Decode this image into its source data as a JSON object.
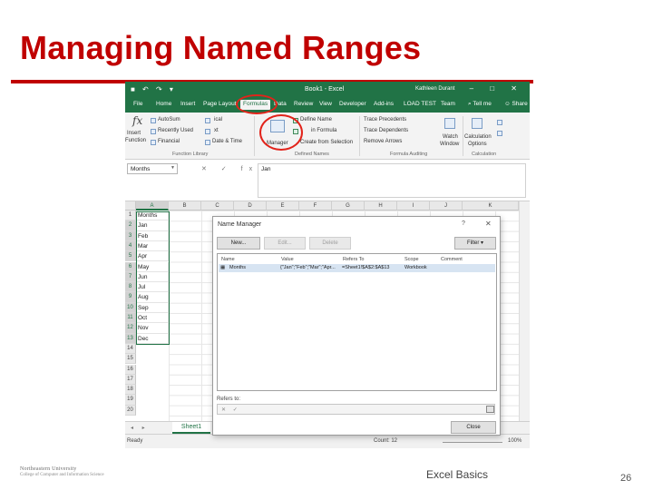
{
  "slide": {
    "title": "Managing Named Ranges",
    "footer_text": "Excel Basics",
    "page_number": "26",
    "logo_line1": "Northeastern University",
    "logo_line2": "College of Computer and Information Science",
    "accent_color": "#c00000"
  },
  "excel": {
    "qat": "■ ↶ ↷ ▾",
    "book_title": "Book1 - Excel",
    "user_name": "Kathleen Durant",
    "window_controls": "– □ ✕",
    "brand_color": "#217346",
    "tabs": [
      "File",
      "Home",
      "Insert",
      "Page Layout",
      "Formulas",
      "Data",
      "Review",
      "View",
      "Developer",
      "Add-ins",
      "LOAD TEST",
      "Team"
    ],
    "active_tab": "Formulas",
    "tell_me": "⌕ Tell me",
    "share": "☺ Share",
    "ribbon": {
      "fx_label": "fx",
      "insert_function": "Insert",
      "function_label": "Function",
      "autosum": "AutoSum",
      "recently_used": "Recently Used",
      "financial": "Financial",
      "logical": "ical",
      "text": "xt",
      "date_time": "Date & Time",
      "library_group": "Function Library",
      "name_manager": "Manager",
      "define_name": "Define Name",
      "use_in_formula": "in Formula",
      "create_from_selection": "Create from Selection",
      "defined_names_group": "Defined Names",
      "trace_precedents": "Trace Precedents",
      "trace_dependents": "Trace Dependents",
      "remove_arrows": "Remove Arrows",
      "auditing_group": "Formula Auditing",
      "watch": "Watch",
      "window": "Window",
      "calculation": "Calculation",
      "options": "Options",
      "calculation_group": "Calculation"
    },
    "formula_bar": {
      "name_box": "Months",
      "icons": "✕ ✓ fx",
      "value": "Jan"
    },
    "columns": [
      "A",
      "B",
      "C",
      "D",
      "E",
      "F",
      "G",
      "H",
      "I",
      "J",
      "K"
    ],
    "rows": [
      "1",
      "2",
      "3",
      "4",
      "5",
      "6",
      "7",
      "8",
      "9",
      "10",
      "11",
      "12",
      "13",
      "14",
      "15",
      "16",
      "17",
      "18",
      "19",
      "20"
    ],
    "cells": [
      "Months",
      "Jan",
      "Feb",
      "Mar",
      "Apr",
      "May",
      "Jun",
      "Jul",
      "Aug",
      "Sep",
      "Oct",
      "Nov",
      "Dec"
    ],
    "sheet_arrows": "◂ ▸",
    "sheet_tab": "Sheet1",
    "status": {
      "ready": "Ready",
      "count": "Count: 12",
      "zoom": "100%"
    },
    "name_manager": {
      "title": "Name Manager",
      "help": "?",
      "close": "✕",
      "new_btn": "New...",
      "edit_btn": "Edit...",
      "delete_btn": "Delete",
      "filter_btn": "Filter ▾",
      "headers": {
        "name": "Name",
        "value": "Value",
        "refers_to": "Refers To",
        "scope": "Scope",
        "comment": "Comment"
      },
      "row": {
        "name": "Months",
        "value": "{\"Jan\";\"Feb\";\"Mar\";\"Apr...",
        "refers_to": "=Sheet1!$A$2:$A$13",
        "scope": "Workbook",
        "comment": ""
      },
      "refers_label": "Refers to:",
      "refers_icons": "✕ ✓",
      "close_btn": "Close"
    }
  }
}
